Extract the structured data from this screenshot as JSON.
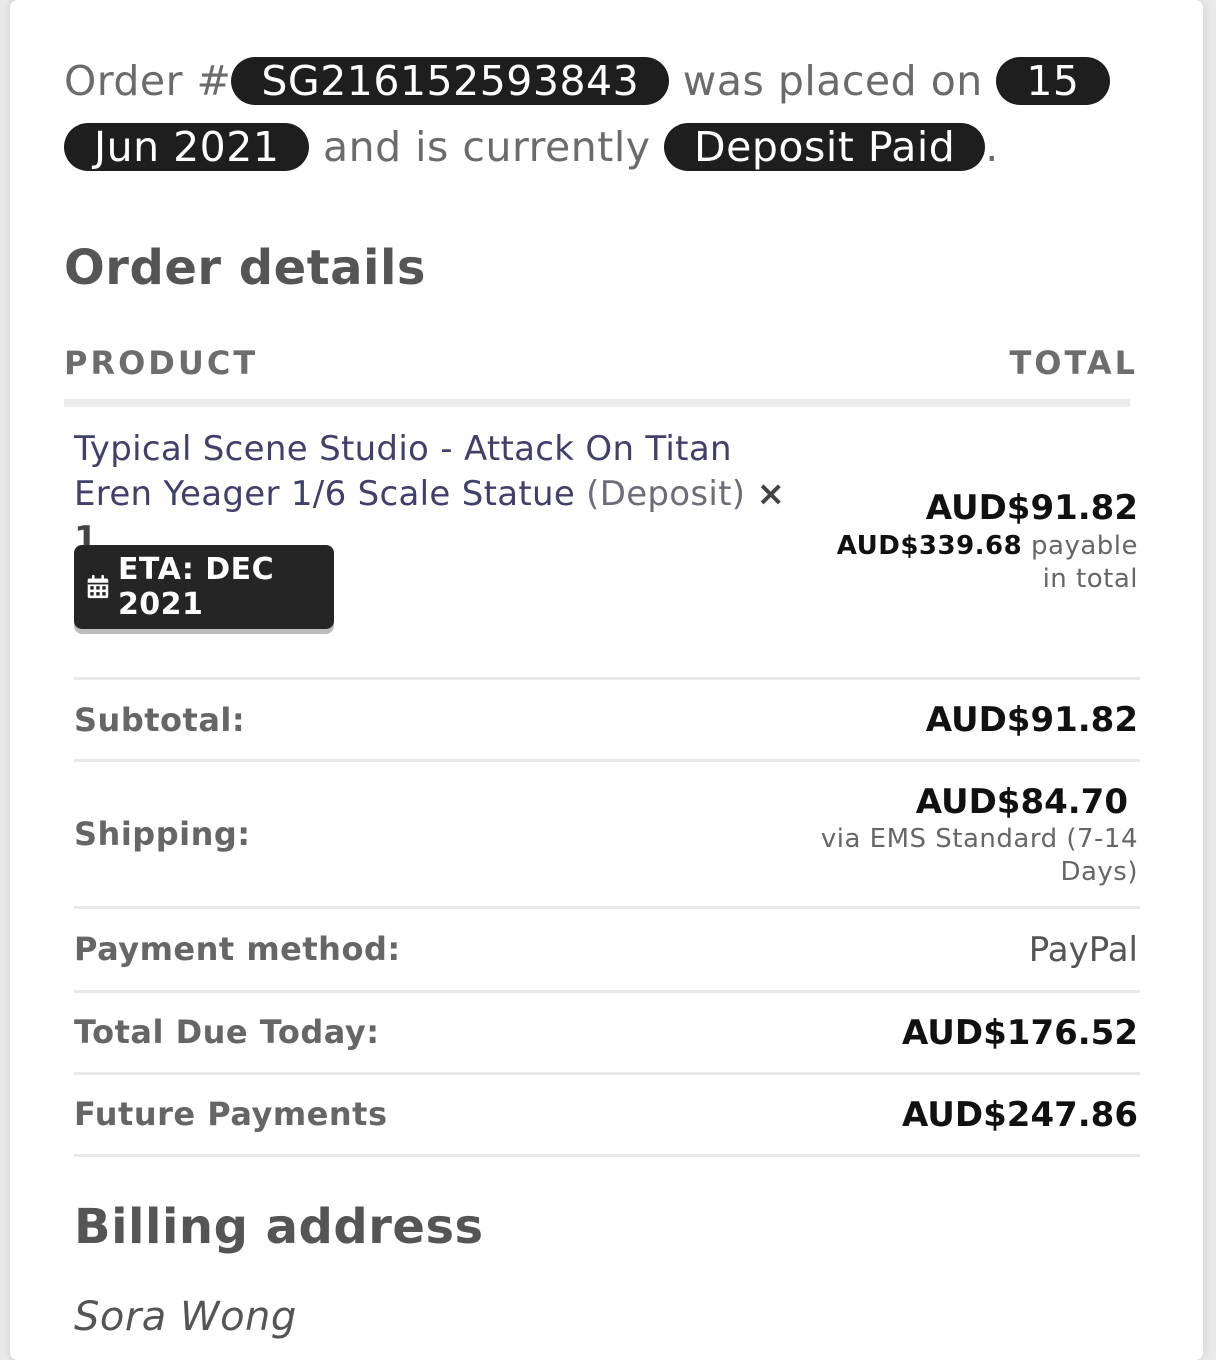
{
  "order_status": {
    "prefix": "Order #",
    "order_number": "SG216152593843",
    "placed_text": "was placed on",
    "date": "15 Jun 2021",
    "current_text": "and is currently",
    "status": "Deposit Paid",
    "suffix": "."
  },
  "order_details": {
    "title": "Order details",
    "col_product": "PRODUCT",
    "col_total": "TOTAL",
    "item": {
      "name": "Typical Scene Studio - Attack On Titan Eren Yeager 1/6 Scale Statue",
      "deposit_label": "(Deposit)",
      "quantity": "× 1",
      "eta": "ETA: DEC 2021",
      "price": "AUD$91.82",
      "total_amount": "AUD$339.68",
      "total_note": "payable in total"
    },
    "rows": {
      "subtotal_label": "Subtotal:",
      "subtotal_value": "AUD$91.82",
      "shipping_label": "Shipping:",
      "shipping_value": "AUD$84.70",
      "shipping_via": "via EMS Standard (7-14 Days)",
      "payment_label": "Payment method:",
      "payment_value": "PayPal",
      "due_label": "Total Due Today:",
      "due_value": "AUD$176.52",
      "future_label": "Future Payments",
      "future_value": "AUD$247.86"
    }
  },
  "billing": {
    "title": "Billing address",
    "name": "Sora Wong"
  },
  "colors": {
    "pill_bg": "#1e1e1e",
    "product_link": "#40406a"
  },
  "icons": {
    "eta": "calendar-icon"
  }
}
